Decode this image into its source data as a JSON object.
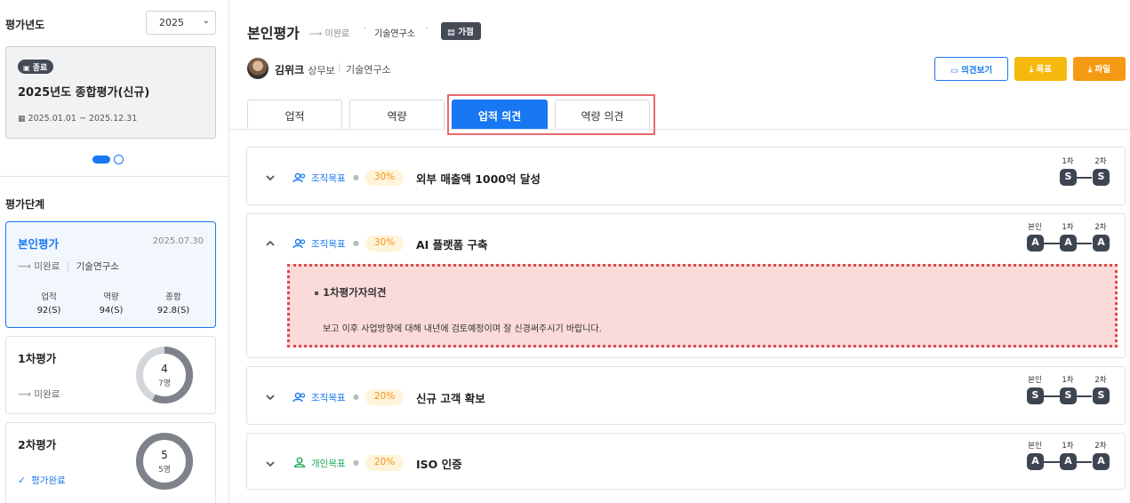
{
  "sidebar": {
    "year_title": "평가년도",
    "year_value": "2025",
    "period_card": {
      "badge": "종료",
      "title": "2025년도 종합평가(신규)",
      "date_range": "2025.01.01 ~ 2025.12.31"
    },
    "stage_title": "평가단계",
    "self_eval": {
      "name": "본인평가",
      "date": "2025.07.30",
      "status": "미완료",
      "dept": "기술연구소",
      "scores": [
        {
          "label": "업적",
          "value": "92(S)"
        },
        {
          "label": "역량",
          "value": "94(S)"
        },
        {
          "label": "종합",
          "value": "92.8(S)"
        }
      ]
    },
    "first_eval": {
      "name": "1차평가",
      "status": "미완료",
      "count": "4",
      "total": "7명",
      "progress": 0.57
    },
    "second_eval": {
      "name": "2차평가",
      "status": "평가완료",
      "count": "5",
      "total": "5명",
      "progress": 1.0
    }
  },
  "header": {
    "title": "본인평가",
    "status": "미완료",
    "dept": "기술연구소",
    "tag": "가점",
    "person_name": "김위크",
    "person_rank": "상무보",
    "person_dept": "기술연구소"
  },
  "actions": {
    "opinion_view": "의견보기",
    "goal": "목표",
    "file": "파일"
  },
  "tabs": [
    "업적",
    "역량",
    "업적 의견",
    "역량 의견"
  ],
  "goals": [
    {
      "type": "조직목표",
      "weight": "30%",
      "title": "외부 매출액 1000억 달성",
      "grades": [
        {
          "label": "1차",
          "value": "S"
        },
        {
          "label": "2차",
          "value": "S"
        }
      ]
    },
    {
      "type": "조직목표",
      "weight": "30%",
      "title": "AI 플랫폼 구축",
      "grades": [
        {
          "label": "본인",
          "value": "A"
        },
        {
          "label": "1차",
          "value": "A"
        },
        {
          "label": "2차",
          "value": "A"
        }
      ],
      "opinion_title": "1차평가자의견",
      "opinion_text": "보고 이후 사업방향에 대해 내년에 검토예정이며 잘 신경써주시기 바랍니다."
    },
    {
      "type": "조직목표",
      "weight": "20%",
      "title": "신규 고객 확보",
      "grades": [
        {
          "label": "본인",
          "value": "S"
        },
        {
          "label": "1차",
          "value": "S"
        },
        {
          "label": "2차",
          "value": "S"
        }
      ]
    },
    {
      "type": "개인목표",
      "weight": "20%",
      "title": "ISO 인증",
      "grades": [
        {
          "label": "본인",
          "value": "A"
        },
        {
          "label": "1차",
          "value": "A"
        },
        {
          "label": "2차",
          "value": "A"
        }
      ]
    }
  ],
  "colors": {
    "primary": "#1877f2",
    "yellow": "#f5b80c",
    "orange": "#f59a12",
    "dark": "#3d4452",
    "org_goal": "#1877f2",
    "personal_goal": "#22a95a"
  }
}
